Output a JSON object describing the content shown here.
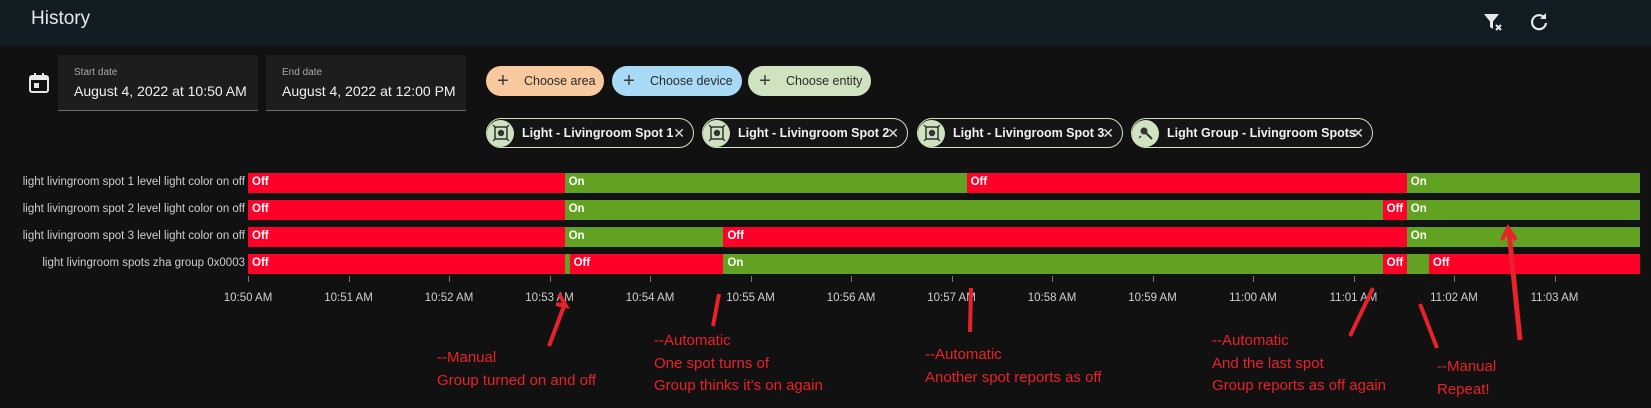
{
  "header": {
    "title": "History",
    "clear_filter_icon": "filter-remove-icon",
    "refresh_icon": "refresh-icon"
  },
  "date_range": {
    "start": {
      "label": "Start date",
      "value": "August 4, 2022 at 10:50 AM"
    },
    "end": {
      "label": "End date",
      "value": "August 4, 2022 at 12:00 PM"
    }
  },
  "target_picker": {
    "area": {
      "label": "Choose area",
      "color": "#f8c99f"
    },
    "device": {
      "label": "Choose device",
      "color": "#a8daf6"
    },
    "entity": {
      "label": "Choose entity",
      "color": "#cfe3c0"
    }
  },
  "selected_entities": [
    {
      "label": "Light - Livingroom Spot 1",
      "icon": "ceiling-light-icon"
    },
    {
      "label": "Light - Livingroom Spot 2",
      "icon": "ceiling-light-icon"
    },
    {
      "label": "Light - Livingroom Spot 3",
      "icon": "ceiling-light-icon"
    },
    {
      "label": "Light Group - Livingroom Spots",
      "icon": "lightbulb-group-icon"
    }
  ],
  "colors": {
    "on": "#62a222",
    "off": "#ff0029"
  },
  "timeline": {
    "start": "10:50 AM",
    "end": "11:03:50 AM",
    "ticks": [
      "10:50 AM",
      "10:51 AM",
      "10:52 AM",
      "10:53 AM",
      "10:54 AM",
      "10:55 AM",
      "10:56 AM",
      "10:57 AM",
      "10:58 AM",
      "10:59 AM",
      "11:00 AM",
      "11:01 AM",
      "11:02 AM",
      "11:03 AM"
    ],
    "rows": [
      {
        "label": "light livingroom spot 1 level light color on off",
        "segments": [
          {
            "state": "Off",
            "text": "Off",
            "until_min": 3.15
          },
          {
            "state": "On",
            "text": "On",
            "until_min": 7.15
          },
          {
            "state": "Off",
            "text": "Off",
            "until_min": 11.53
          },
          {
            "state": "On",
            "text": "On",
            "until_min": 13.85
          }
        ]
      },
      {
        "label": "light livingroom spot 2 level light color on off",
        "segments": [
          {
            "state": "Off",
            "text": "Off",
            "until_min": 3.15
          },
          {
            "state": "On",
            "text": "On",
            "until_min": 11.29
          },
          {
            "state": "Off",
            "text": "Off",
            "until_min": 11.53
          },
          {
            "state": "On",
            "text": "On",
            "until_min": 13.85
          }
        ]
      },
      {
        "label": "light livingroom spot 3 level light color on off",
        "segments": [
          {
            "state": "Off",
            "text": "Off",
            "until_min": 3.15
          },
          {
            "state": "On",
            "text": "On",
            "until_min": 4.73
          },
          {
            "state": "Off",
            "text": "Off",
            "until_min": 11.53
          },
          {
            "state": "On",
            "text": "On",
            "until_min": 13.85
          }
        ]
      },
      {
        "label": "light livingroom spots zha group 0x0003",
        "segments": [
          {
            "state": "Off",
            "text": "Off",
            "until_min": 3.15
          },
          {
            "state": "On",
            "text": "",
            "until_min": 3.2
          },
          {
            "state": "Off",
            "text": "Off",
            "until_min": 4.73
          },
          {
            "state": "On",
            "text": "On",
            "until_min": 11.29
          },
          {
            "state": "Off",
            "text": "Off",
            "until_min": 11.53
          },
          {
            "state": "On",
            "text": "",
            "until_min": 11.75
          },
          {
            "state": "Off",
            "text": "Off",
            "until_min": 13.85
          }
        ]
      }
    ]
  },
  "annotations": [
    {
      "lines": [
        "--Manual",
        "Group turned on and off"
      ]
    },
    {
      "lines": [
        "--Automatic",
        "One spot turns of",
        "Group thinks it's on again"
      ]
    },
    {
      "lines": [
        "--Automatic",
        "Another spot reports as off"
      ]
    },
    {
      "lines": [
        "--Automatic",
        "And the last spot",
        "Group reports as off again"
      ]
    },
    {
      "lines": [
        "--Manual",
        "Repeat!"
      ]
    }
  ]
}
